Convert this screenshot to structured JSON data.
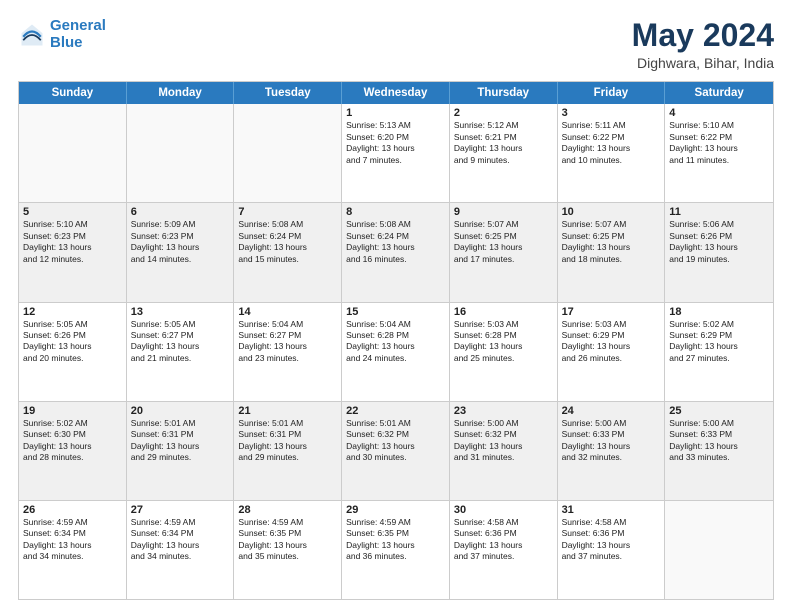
{
  "header": {
    "logo_line1": "General",
    "logo_line2": "Blue",
    "title": "May 2024",
    "subtitle": "Dighwara, Bihar, India"
  },
  "days": [
    "Sunday",
    "Monday",
    "Tuesday",
    "Wednesday",
    "Thursday",
    "Friday",
    "Saturday"
  ],
  "weeks": [
    [
      {
        "day": "",
        "lines": []
      },
      {
        "day": "",
        "lines": []
      },
      {
        "day": "",
        "lines": []
      },
      {
        "day": "1",
        "lines": [
          "Sunrise: 5:13 AM",
          "Sunset: 6:20 PM",
          "Daylight: 13 hours",
          "and 7 minutes."
        ]
      },
      {
        "day": "2",
        "lines": [
          "Sunrise: 5:12 AM",
          "Sunset: 6:21 PM",
          "Daylight: 13 hours",
          "and 9 minutes."
        ]
      },
      {
        "day": "3",
        "lines": [
          "Sunrise: 5:11 AM",
          "Sunset: 6:22 PM",
          "Daylight: 13 hours",
          "and 10 minutes."
        ]
      },
      {
        "day": "4",
        "lines": [
          "Sunrise: 5:10 AM",
          "Sunset: 6:22 PM",
          "Daylight: 13 hours",
          "and 11 minutes."
        ]
      }
    ],
    [
      {
        "day": "5",
        "lines": [
          "Sunrise: 5:10 AM",
          "Sunset: 6:23 PM",
          "Daylight: 13 hours",
          "and 12 minutes."
        ]
      },
      {
        "day": "6",
        "lines": [
          "Sunrise: 5:09 AM",
          "Sunset: 6:23 PM",
          "Daylight: 13 hours",
          "and 14 minutes."
        ]
      },
      {
        "day": "7",
        "lines": [
          "Sunrise: 5:08 AM",
          "Sunset: 6:24 PM",
          "Daylight: 13 hours",
          "and 15 minutes."
        ]
      },
      {
        "day": "8",
        "lines": [
          "Sunrise: 5:08 AM",
          "Sunset: 6:24 PM",
          "Daylight: 13 hours",
          "and 16 minutes."
        ]
      },
      {
        "day": "9",
        "lines": [
          "Sunrise: 5:07 AM",
          "Sunset: 6:25 PM",
          "Daylight: 13 hours",
          "and 17 minutes."
        ]
      },
      {
        "day": "10",
        "lines": [
          "Sunrise: 5:07 AM",
          "Sunset: 6:25 PM",
          "Daylight: 13 hours",
          "and 18 minutes."
        ]
      },
      {
        "day": "11",
        "lines": [
          "Sunrise: 5:06 AM",
          "Sunset: 6:26 PM",
          "Daylight: 13 hours",
          "and 19 minutes."
        ]
      }
    ],
    [
      {
        "day": "12",
        "lines": [
          "Sunrise: 5:05 AM",
          "Sunset: 6:26 PM",
          "Daylight: 13 hours",
          "and 20 minutes."
        ]
      },
      {
        "day": "13",
        "lines": [
          "Sunrise: 5:05 AM",
          "Sunset: 6:27 PM",
          "Daylight: 13 hours",
          "and 21 minutes."
        ]
      },
      {
        "day": "14",
        "lines": [
          "Sunrise: 5:04 AM",
          "Sunset: 6:27 PM",
          "Daylight: 13 hours",
          "and 23 minutes."
        ]
      },
      {
        "day": "15",
        "lines": [
          "Sunrise: 5:04 AM",
          "Sunset: 6:28 PM",
          "Daylight: 13 hours",
          "and 24 minutes."
        ]
      },
      {
        "day": "16",
        "lines": [
          "Sunrise: 5:03 AM",
          "Sunset: 6:28 PM",
          "Daylight: 13 hours",
          "and 25 minutes."
        ]
      },
      {
        "day": "17",
        "lines": [
          "Sunrise: 5:03 AM",
          "Sunset: 6:29 PM",
          "Daylight: 13 hours",
          "and 26 minutes."
        ]
      },
      {
        "day": "18",
        "lines": [
          "Sunrise: 5:02 AM",
          "Sunset: 6:29 PM",
          "Daylight: 13 hours",
          "and 27 minutes."
        ]
      }
    ],
    [
      {
        "day": "19",
        "lines": [
          "Sunrise: 5:02 AM",
          "Sunset: 6:30 PM",
          "Daylight: 13 hours",
          "and 28 minutes."
        ]
      },
      {
        "day": "20",
        "lines": [
          "Sunrise: 5:01 AM",
          "Sunset: 6:31 PM",
          "Daylight: 13 hours",
          "and 29 minutes."
        ]
      },
      {
        "day": "21",
        "lines": [
          "Sunrise: 5:01 AM",
          "Sunset: 6:31 PM",
          "Daylight: 13 hours",
          "and 29 minutes."
        ]
      },
      {
        "day": "22",
        "lines": [
          "Sunrise: 5:01 AM",
          "Sunset: 6:32 PM",
          "Daylight: 13 hours",
          "and 30 minutes."
        ]
      },
      {
        "day": "23",
        "lines": [
          "Sunrise: 5:00 AM",
          "Sunset: 6:32 PM",
          "Daylight: 13 hours",
          "and 31 minutes."
        ]
      },
      {
        "day": "24",
        "lines": [
          "Sunrise: 5:00 AM",
          "Sunset: 6:33 PM",
          "Daylight: 13 hours",
          "and 32 minutes."
        ]
      },
      {
        "day": "25",
        "lines": [
          "Sunrise: 5:00 AM",
          "Sunset: 6:33 PM",
          "Daylight: 13 hours",
          "and 33 minutes."
        ]
      }
    ],
    [
      {
        "day": "26",
        "lines": [
          "Sunrise: 4:59 AM",
          "Sunset: 6:34 PM",
          "Daylight: 13 hours",
          "and 34 minutes."
        ]
      },
      {
        "day": "27",
        "lines": [
          "Sunrise: 4:59 AM",
          "Sunset: 6:34 PM",
          "Daylight: 13 hours",
          "and 34 minutes."
        ]
      },
      {
        "day": "28",
        "lines": [
          "Sunrise: 4:59 AM",
          "Sunset: 6:35 PM",
          "Daylight: 13 hours",
          "and 35 minutes."
        ]
      },
      {
        "day": "29",
        "lines": [
          "Sunrise: 4:59 AM",
          "Sunset: 6:35 PM",
          "Daylight: 13 hours",
          "and 36 minutes."
        ]
      },
      {
        "day": "30",
        "lines": [
          "Sunrise: 4:58 AM",
          "Sunset: 6:36 PM",
          "Daylight: 13 hours",
          "and 37 minutes."
        ]
      },
      {
        "day": "31",
        "lines": [
          "Sunrise: 4:58 AM",
          "Sunset: 6:36 PM",
          "Daylight: 13 hours",
          "and 37 minutes."
        ]
      },
      {
        "day": "",
        "lines": []
      }
    ]
  ]
}
